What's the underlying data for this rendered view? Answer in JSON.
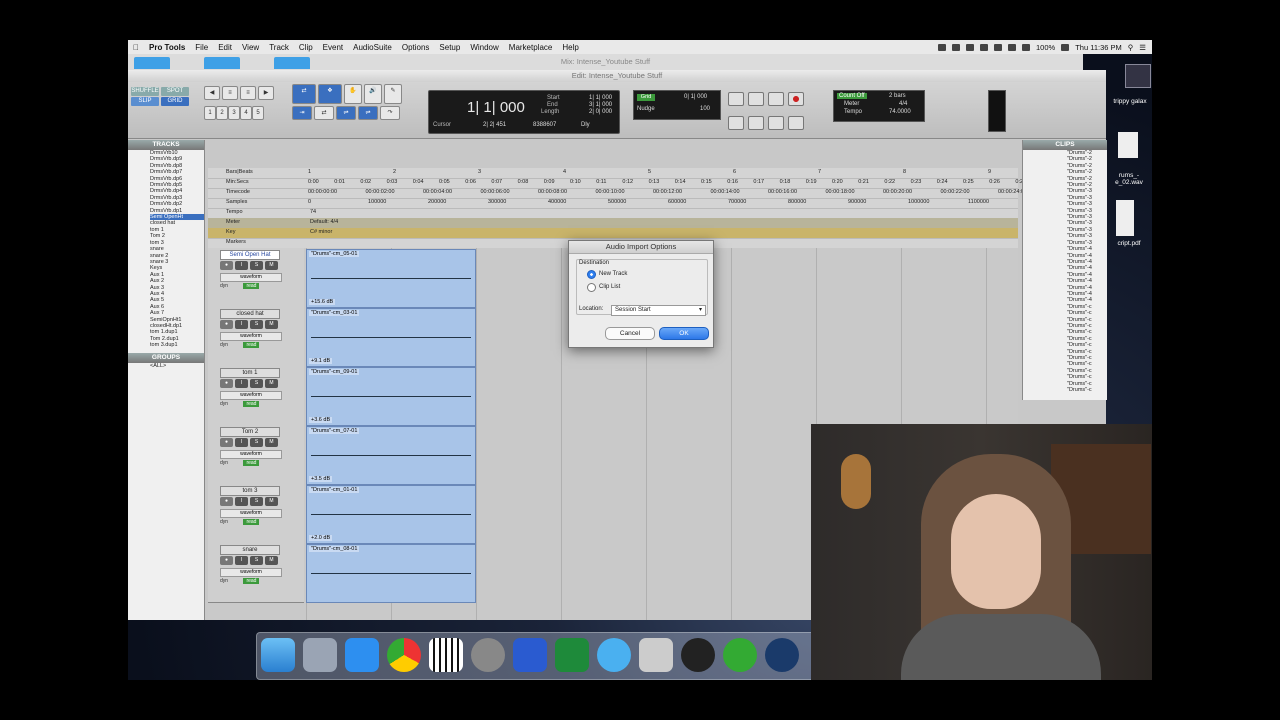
{
  "menubar": {
    "apple": "",
    "app": "Pro Tools",
    "items": [
      "File",
      "Edit",
      "View",
      "Track",
      "Clip",
      "Event",
      "AudioSuite",
      "Options",
      "Setup",
      "Window",
      "Marketplace",
      "Help"
    ],
    "battery": "100%",
    "clock": "Thu 11:36 PM"
  },
  "bg_window_title": "Mix: Intense_Youtube Stuff",
  "edit_window_title": "Edit: Intense_Youtube Stuff",
  "toolbar": {
    "mode_shuffle": "SHUFFLE",
    "mode_spot": "SPOT",
    "mode_slip": "SLIP",
    "mode_grid": "GRID",
    "zoom_presets": [
      "1",
      "2",
      "3",
      "4",
      "5"
    ],
    "counter_main": "1| 1| 000",
    "start_label": "Start",
    "end_label": "End",
    "length_label": "Length",
    "start_val": "1| 1| 000",
    "end_val": "3| 1| 000",
    "length_val": "2| 0| 000",
    "cursor_label": "Cursor",
    "cursor_val": "2| 2| 451",
    "sample_val": "8388607",
    "dly": "Dly",
    "grid_label": "Grid",
    "grid_val": "0| 1| 000",
    "nudge_label": "Nudge",
    "nudge_val": "100",
    "count_off": "Count Off",
    "meter_label": "Meter",
    "tempo_label": "Tempo",
    "bars": "2 bars",
    "meter_val": "4/4",
    "tempo_val": "74.0000"
  },
  "tracks_panel": {
    "header": "TRACKS",
    "items": [
      "DrmsVrb10",
      "DrmsVrb.dp9",
      "DrmsVrb.dp8",
      "DrmsVrb.dp7",
      "DrmsVrb.dp6",
      "DrmsVrb.dp5",
      "DrmsVrb.dp4",
      "DrmsVrb.dp3",
      "DrmsVrb.dp2",
      "DrmsVrb.dp1",
      "Semi OpenHt",
      "closed hat",
      "tom 1",
      "Tom 2",
      "tom 3",
      "snare",
      "snare 2",
      "snare 3",
      "Keys",
      "Aux 1",
      "Aux 2",
      "Aux 3",
      "Aux 4",
      "Aux 5",
      "Aux 6",
      "Aux 7",
      "SemiOpnHt1",
      "closedHt.dp1",
      "tom 1.dup1",
      "Tom 2.dup1",
      "tom 3.dup1"
    ],
    "groups_header": "GROUPS",
    "groups_item": "<ALL>"
  },
  "rulers": {
    "labels": [
      "Bars|Beats",
      "Min:Secs",
      "Timecode",
      "Samples",
      "Tempo",
      "Meter",
      "Key",
      "Markers"
    ],
    "bars": [
      "1",
      "2",
      "3",
      "4",
      "5",
      "6",
      "7",
      "8",
      "9"
    ],
    "minsecs": [
      "0:00",
      "0:01",
      "0:02",
      "0:03",
      "0:04",
      "0:05",
      "0:06",
      "0:07",
      "0:08",
      "0:09",
      "0:10",
      "0:11",
      "0:12",
      "0:13",
      "0:14",
      "0:15",
      "0:16",
      "0:17",
      "0:18",
      "0:19",
      "0:20",
      "0:21",
      "0:22",
      "0:23",
      "0:24",
      "0:25",
      "0:26",
      "0:27",
      "0:28"
    ],
    "timecode": [
      "00:00:00:00",
      "00:00:02:00",
      "00:00:04:00",
      "00:00:06:00",
      "00:00:08:00",
      "00:00:10:00",
      "00:00:12:00",
      "00:00:14:00",
      "00:00:16:00",
      "00:00:18:00",
      "00:00:20:00",
      "00:00:22:00",
      "00:00:24:00",
      "00:00:26:00"
    ],
    "samples": [
      "0",
      "100000",
      "200000",
      "300000",
      "400000",
      "500000",
      "600000",
      "700000",
      "800000",
      "900000",
      "1000000",
      "1100000"
    ],
    "tempo_marker": "74",
    "meter_marker": "Default: 4/4",
    "key_marker": "C# minor"
  },
  "tracks": [
    {
      "name": "Semi Open Hat",
      "selected": true,
      "clip": "\"Drums\"-cm_05-01",
      "db": "+15.6 dB"
    },
    {
      "name": "closed hat",
      "selected": false,
      "clip": "\"Drums\"-cm_03-01",
      "db": "+9.1 dB"
    },
    {
      "name": "tom 1",
      "selected": false,
      "clip": "\"Drums\"-cm_09-01",
      "db": "+3.6 dB"
    },
    {
      "name": "Tom 2",
      "selected": false,
      "clip": "\"Drums\"-cm_07-01",
      "db": "+3.5 dB"
    },
    {
      "name": "tom 3",
      "selected": false,
      "clip": "\"Drums\"-cm_01-01",
      "db": "+2.0 dB"
    },
    {
      "name": "snare",
      "selected": false,
      "clip": "\"Drums\"-cm_08-01",
      "db": ""
    }
  ],
  "track_controls": {
    "rec": "●",
    "input": "I",
    "solo": "S",
    "mute": "M",
    "view": "waveform",
    "dyn": "dyn",
    "read": "read"
  },
  "clips_panel": {
    "header": "CLIPS",
    "items": [
      "\"Drums\"-2",
      "\"Drums\"-2",
      "\"Drums\"-2",
      "\"Drums\"-2",
      "\"Drums\"-2",
      "\"Drums\"-2",
      "\"Drums\"-3",
      "\"Drums\"-3",
      "\"Drums\"-3",
      "\"Drums\"-3",
      "\"Drums\"-3",
      "\"Drums\"-3",
      "\"Drums\"-3",
      "\"Drums\"-3",
      "\"Drums\"-3",
      "\"Drums\"-4",
      "\"Drums\"-4",
      "\"Drums\"-4",
      "\"Drums\"-4",
      "\"Drums\"-4",
      "\"Drums\"-4",
      "\"Drums\"-4",
      "\"Drums\"-4",
      "\"Drums\"-4",
      "\"Drums\"-c",
      "\"Drums\"-c",
      "\"Drums\"-c",
      "\"Drums\"-c",
      "\"Drums\"-c",
      "\"Drums\"-c",
      "\"Drums\"-c",
      "\"Drums\"-c",
      "\"Drums\"-c",
      "\"Drums\"-c",
      "\"Drums\"-c",
      "\"Drums\"-c",
      "\"Drums\"-c",
      "\"Drums\"-c"
    ]
  },
  "dialog": {
    "title": "Audio Import Options",
    "destination_label": "Destination",
    "opt_new_track": "New Track",
    "opt_clip_list": "Clip List",
    "location_label": "Location:",
    "location_value": "Session Start",
    "cancel": "Cancel",
    "ok": "OK"
  },
  "desktop": {
    "icon1": "trippy galax",
    "icon2": "rums_-\ne_02.wav",
    "icon3": "cript.pdf"
  },
  "colors": {
    "accent": "#2d78e8",
    "clip": "#a8c4e8",
    "selected_track": "#3a6fbf"
  }
}
